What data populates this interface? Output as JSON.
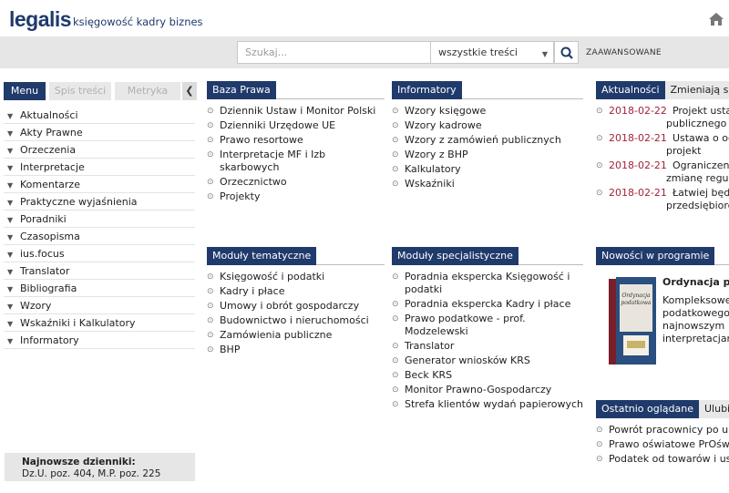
{
  "header": {
    "logo": "legalis",
    "tagline": "księgowość kadry biznes"
  },
  "search": {
    "placeholder": "Szukaj...",
    "scope": "wszystkie treści",
    "advanced": "ZAAWANSOWANE"
  },
  "sidebar": {
    "tabs": [
      "Menu",
      "Spis treści",
      "Metryka"
    ],
    "items": [
      "Aktualności",
      "Akty Prawne",
      "Orzeczenia",
      "Interpretacje",
      "Komentarze",
      "Praktyczne wyjaśnienia",
      "Poradniki",
      "Czasopisma",
      "ius.focus",
      "Translator",
      "Bibliografia",
      "Wzory",
      "Wskaźniki i Kalkulatory",
      "Informatory"
    ],
    "latest": {
      "title": "Najnowsze dzienniki:",
      "text": "Dz.U. poz. 404, M.P. poz. 225"
    }
  },
  "baza": {
    "title": "Baza Prawa",
    "items": [
      "Dziennik Ustaw i Monitor Polski",
      "Dzienniki Urzędowe UE",
      "Prawo resortowe",
      "Interpretacje MF i Izb skarbowych",
      "Orzecznictwo",
      "Projekty"
    ]
  },
  "informatory": {
    "title": "Informatory",
    "items": [
      "Wzory księgowe",
      "Wzory kadrowe",
      "Wzory z zamówień publicznych",
      "Wzory z BHP",
      "Kalkulatory",
      "Wskaźniki"
    ]
  },
  "news": {
    "tab_active": "Aktualności",
    "tab_other": "Zmieniają się",
    "items": [
      {
        "date": "2018-02-22",
        "l1": "Projekt ustawy",
        "l2": "publicznego a z"
      },
      {
        "date": "2018-02-21",
        "l1": "Ustawa o ochr",
        "l2": "projekt"
      },
      {
        "date": "2018-02-21",
        "l1": "Ograniczenie h",
        "l2": "zmianę regulam"
      },
      {
        "date": "2018-02-21",
        "l1": "Łatwiej będzie",
        "l2": "przedsiębiorco"
      }
    ]
  },
  "tematyczne": {
    "title": "Moduły tematyczne",
    "items": [
      "Księgowość i podatki",
      "Kadry i płace",
      "Umowy i obrót gospodarczy",
      "Budownictwo i nieruchomości",
      "Zamówienia publiczne",
      "BHP"
    ]
  },
  "specjalistyczne": {
    "title": "Moduły specjalistyczne",
    "items": [
      [
        "Poradnia ekspercka Księgowość i",
        "podatki"
      ],
      [
        "Poradnia ekspercka Kadry i płace"
      ],
      [
        "Prawo podatkowe - prof.",
        "Modzelewski"
      ],
      [
        "Translator"
      ],
      [
        "Generator wniosków KRS"
      ],
      [
        "Beck KRS"
      ],
      [
        "Monitor Prawno-Gospodarczy"
      ],
      [
        "Strefa klientów wydań papierowych"
      ]
    ]
  },
  "promo": {
    "title": "Nowości w programie",
    "book_title": "Ordynacja podatkowa",
    "heading": "Ordynacja pod",
    "lines": [
      "Kompleksowe",
      "podatkowego",
      "najnowszym",
      "interpretacjam"
    ]
  },
  "recent": {
    "tab_active": "Ostatnio oglądane",
    "tab_other": "Ulubione",
    "items": [
      "Powrót pracownicy po urlo",
      "Prawo oświatowe PrOśw",
      "Podatek od towarów i usług"
    ]
  },
  "colors": {
    "navy": "#1f3a6b",
    "date": "#a4233a"
  }
}
